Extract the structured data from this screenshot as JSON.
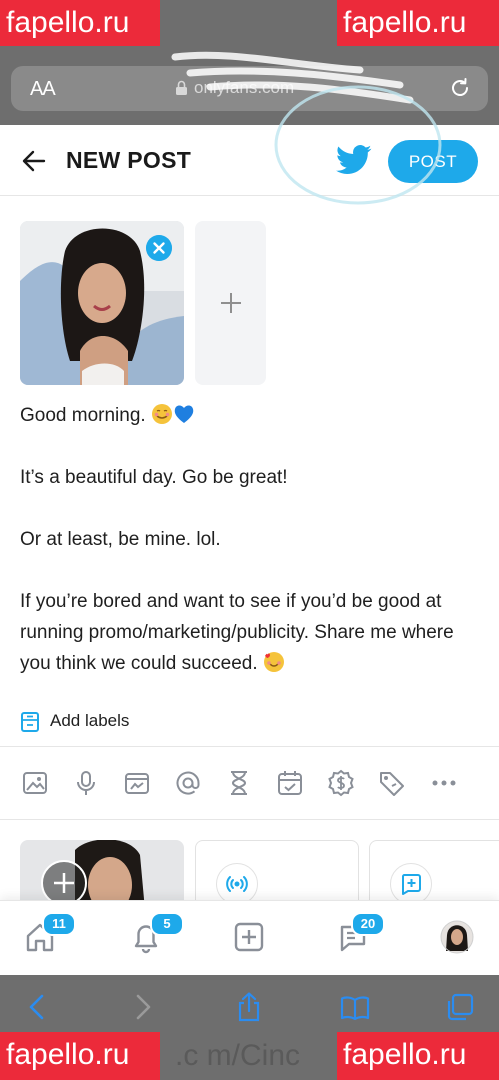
{
  "browser": {
    "aa_label": "AA",
    "url": "onlyfans.com",
    "bottom_url_fragment": ".c m/Cinc"
  },
  "watermarks": {
    "top_left": "fapello.ru",
    "top_right": "fapello.ru",
    "bottom_left": "fapello.ru",
    "bottom_right": "fapello.ru"
  },
  "header": {
    "title": "NEW POST",
    "post_label": "POST"
  },
  "post": {
    "lines": [
      "Good morning.",
      "It’s a beautiful day. Go be great!",
      "Or at least, be mine. lol.",
      "If you’re bored and want to see if you’d be good at running promo/marketing/publicity. Share me where you think we could succeed."
    ]
  },
  "labels": {
    "add_label": "Add labels"
  },
  "toolbar": {
    "icons": [
      "image-icon",
      "microphone-icon",
      "vault-icon",
      "mention-icon",
      "hourglass-icon",
      "calendar-icon",
      "price-icon",
      "tag-icon",
      "more-icon"
    ]
  },
  "bottom_nav": {
    "home_badge": "11",
    "notifications_badge": "5",
    "messages_badge": "20"
  },
  "colors": {
    "accent": "#1ea9ea",
    "watermark": "#ec2a3a",
    "safari_gray": "#6e6e6e"
  }
}
